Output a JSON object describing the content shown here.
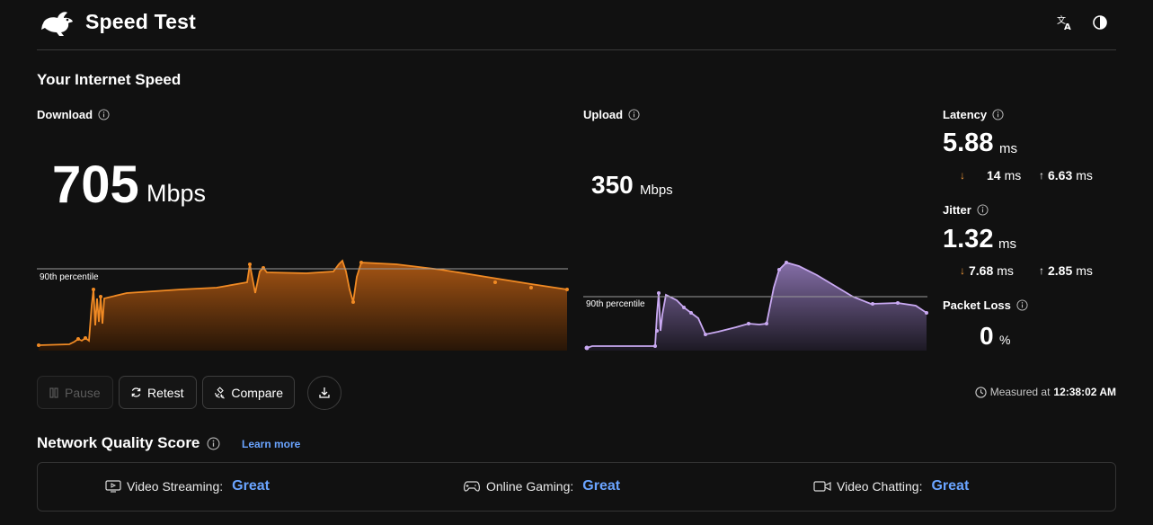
{
  "header": {
    "title": "Speed Test",
    "icons": [
      "rabbit-logo-icon",
      "translate-icon",
      "contrast-icon"
    ]
  },
  "section_title": "Your Internet Speed",
  "download": {
    "label": "Download",
    "value": "705",
    "unit": "Mbps",
    "percentile_label": "90th percentile",
    "color": "#f08a24"
  },
  "upload": {
    "label": "Upload",
    "value": "350",
    "unit": "Mbps",
    "percentile_label": "90th percentile",
    "color": "#c9a9f2"
  },
  "latency": {
    "label": "Latency",
    "value": "5.88",
    "unit": "ms",
    "down": "14",
    "down_unit": "ms",
    "up": "6.63",
    "up_unit": "ms"
  },
  "jitter": {
    "label": "Jitter",
    "value": "1.32",
    "unit": "ms",
    "down": "7.68",
    "down_unit": "ms",
    "up": "2.85",
    "up_unit": "ms"
  },
  "packet_loss": {
    "label": "Packet Loss",
    "value": "0",
    "unit": "%"
  },
  "controls": {
    "pause": "Pause",
    "retest": "Retest",
    "compare": "Compare"
  },
  "measured": {
    "prefix": "Measured at",
    "time": "12:38:02 AM"
  },
  "network_quality": {
    "title": "Network Quality Score",
    "learn_more": "Learn more",
    "items": [
      {
        "label": "Video Streaming:",
        "score": "Great"
      },
      {
        "label": "Online Gaming:",
        "score": "Great"
      },
      {
        "label": "Video Chatting:",
        "score": "Great"
      }
    ]
  },
  "colors": {
    "accent_blue": "#6aa4ff",
    "download_orange": "#f08a24",
    "upload_purple": "#c9a9f2"
  }
}
